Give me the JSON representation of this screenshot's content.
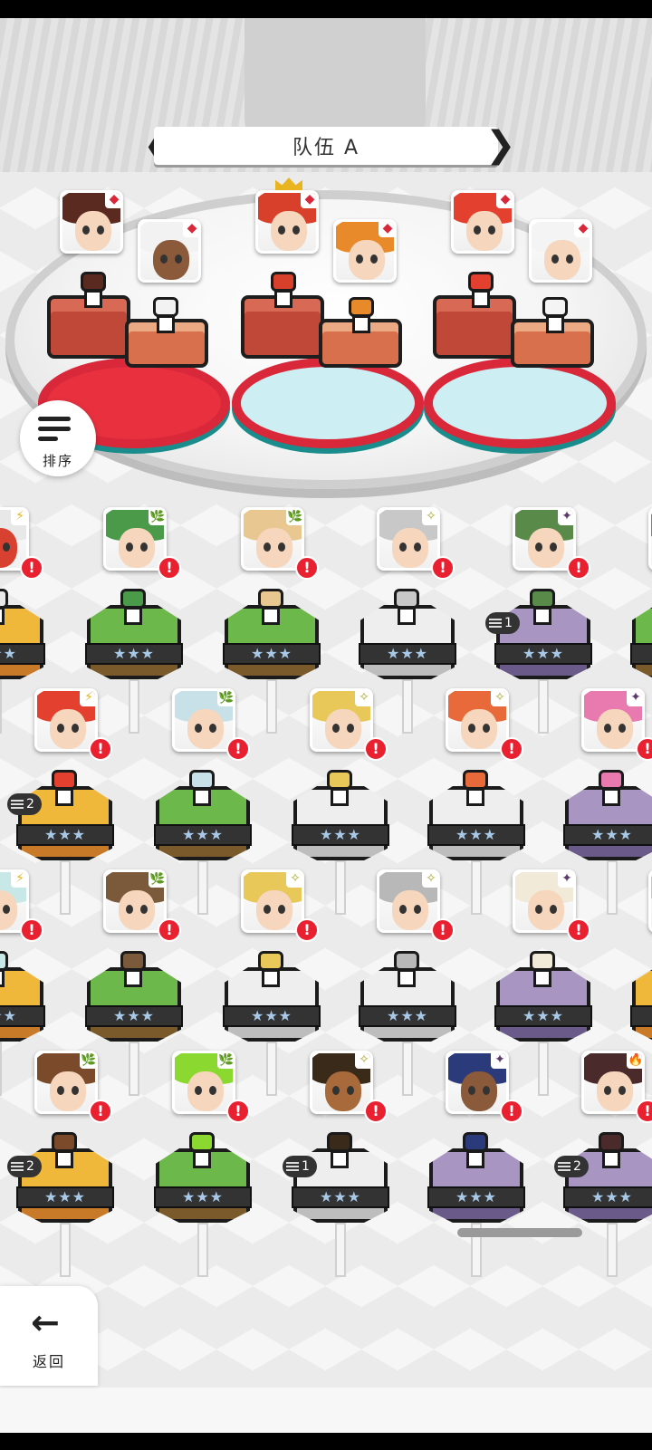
{
  "team": {
    "title": "队伍 A",
    "prev_glyph": "❮",
    "next_glyph": "❯"
  },
  "controls": {
    "sort_label": "排序",
    "back_label": "返回",
    "back_glyph": "←"
  },
  "colors": {
    "grass": "#5aa23a",
    "earth": "#e5a528",
    "stone": "#cfcfcf",
    "violet": "#8c7ba4",
    "warn": "#e82030",
    "accent": "#d8283a"
  },
  "icons": {
    "warning": "!",
    "fire_element": "◆",
    "star_rank": "★"
  },
  "lineup": [
    {
      "slot": 1,
      "leader": false,
      "hair": "#5a2a20",
      "skin": "#f6d6bd",
      "element": "fire"
    },
    {
      "slot": 2,
      "leader": false,
      "hair": "#f2f2f2",
      "skin": "#8a5a3a",
      "element": "fire"
    },
    {
      "slot": 3,
      "leader": true,
      "hair": "#d8402c",
      "skin": "#f6d6bd",
      "element": "fire"
    },
    {
      "slot": 4,
      "leader": false,
      "hair": "#e88a2a",
      "skin": "#f6d6bd",
      "element": "fire"
    },
    {
      "slot": 5,
      "leader": false,
      "hair": "#e44030",
      "skin": "#f6d6bd",
      "element": "fire"
    },
    {
      "slot": 6,
      "leader": false,
      "hair": "#f4f4f4",
      "skin": "#f6d6bd",
      "element": "fire"
    }
  ],
  "roster_rows": [
    [
      {
        "stars": "★★★",
        "color": "earth",
        "hair": "#e8e8e8",
        "skin": "#d84030",
        "element": "⚡",
        "level": ""
      },
      {
        "stars": "★★★",
        "color": "grass",
        "hair": "#4a9a4a",
        "skin": "#f6d6bd",
        "element": "🌿",
        "level": ""
      },
      {
        "stars": "★★★",
        "color": "grass",
        "hair": "#e8c890",
        "skin": "#f6d6bd",
        "element": "🌿",
        "level": ""
      },
      {
        "stars": "★★★",
        "color": "stone",
        "hair": "#c8c8c8",
        "skin": "#f6d6bd",
        "element": "✧",
        "level": ""
      },
      {
        "stars": "★★★",
        "color": "violet",
        "hair": "#5a8a4a",
        "skin": "#f6d6bd",
        "element": "✦",
        "level": "1"
      },
      {
        "stars": "★★★",
        "color": "grass",
        "hair": "#5a9a4a",
        "skin": "#f6d6bd",
        "element": "🌿",
        "level": ""
      }
    ],
    [
      {
        "stars": "★★★",
        "color": "earth",
        "hair": "#e44030",
        "skin": "#f6d6bd",
        "element": "⚡",
        "level": "2"
      },
      {
        "stars": "★★★",
        "color": "grass",
        "hair": "#c8e0e8",
        "skin": "#f6d6bd",
        "element": "🌿",
        "level": ""
      },
      {
        "stars": "★★★",
        "color": "stone",
        "hair": "#e8c858",
        "skin": "#f6d6bd",
        "element": "✧",
        "level": ""
      },
      {
        "stars": "★★★",
        "color": "stone",
        "hair": "#e86a3a",
        "skin": "#f6d6bd",
        "element": "✧",
        "level": ""
      },
      {
        "stars": "★★★",
        "color": "violet",
        "hair": "#e87ab0",
        "skin": "#f6d6bd",
        "element": "✦",
        "level": ""
      }
    ],
    [
      {
        "stars": "★★★",
        "color": "earth",
        "hair": "#c8e8e8",
        "skin": "#f6d6bd",
        "element": "⚡",
        "level": ""
      },
      {
        "stars": "★★★",
        "color": "grass",
        "hair": "#7a5a3a",
        "skin": "#f6d6bd",
        "element": "🌿",
        "level": ""
      },
      {
        "stars": "★★★",
        "color": "stone",
        "hair": "#e8c858",
        "skin": "#f6d6bd",
        "element": "✧",
        "level": ""
      },
      {
        "stars": "★★★",
        "color": "stone",
        "hair": "#b8b8b8",
        "skin": "#f6d6bd",
        "element": "✧",
        "level": ""
      },
      {
        "stars": "★★★",
        "color": "violet",
        "hair": "#f2ead8",
        "skin": "#f6d6bd",
        "element": "✦",
        "level": ""
      },
      {
        "stars": "★★★",
        "color": "earth",
        "hair": "#e8c858",
        "skin": "#f6d6bd",
        "element": "⚡",
        "level": ""
      }
    ],
    [
      {
        "stars": "★★★",
        "color": "earth",
        "hair": "#7a4a2a",
        "skin": "#f6d6bd",
        "element": "🌿",
        "level": "2"
      },
      {
        "stars": "★★★",
        "color": "grass",
        "hair": "#8ad830",
        "skin": "#f6d6bd",
        "element": "🌿",
        "level": ""
      },
      {
        "stars": "★★★",
        "color": "stone",
        "hair": "#3a2a1a",
        "skin": "#a86a3a",
        "element": "✧",
        "level": "1"
      },
      {
        "stars": "★★★",
        "color": "violet",
        "hair": "#2a3a7a",
        "skin": "#8a5a3a",
        "element": "✦",
        "level": ""
      },
      {
        "stars": "★★★",
        "color": "violet",
        "hair": "#4a2a2a",
        "skin": "#f6d6bd",
        "element": "🔥",
        "level": "2"
      }
    ]
  ]
}
